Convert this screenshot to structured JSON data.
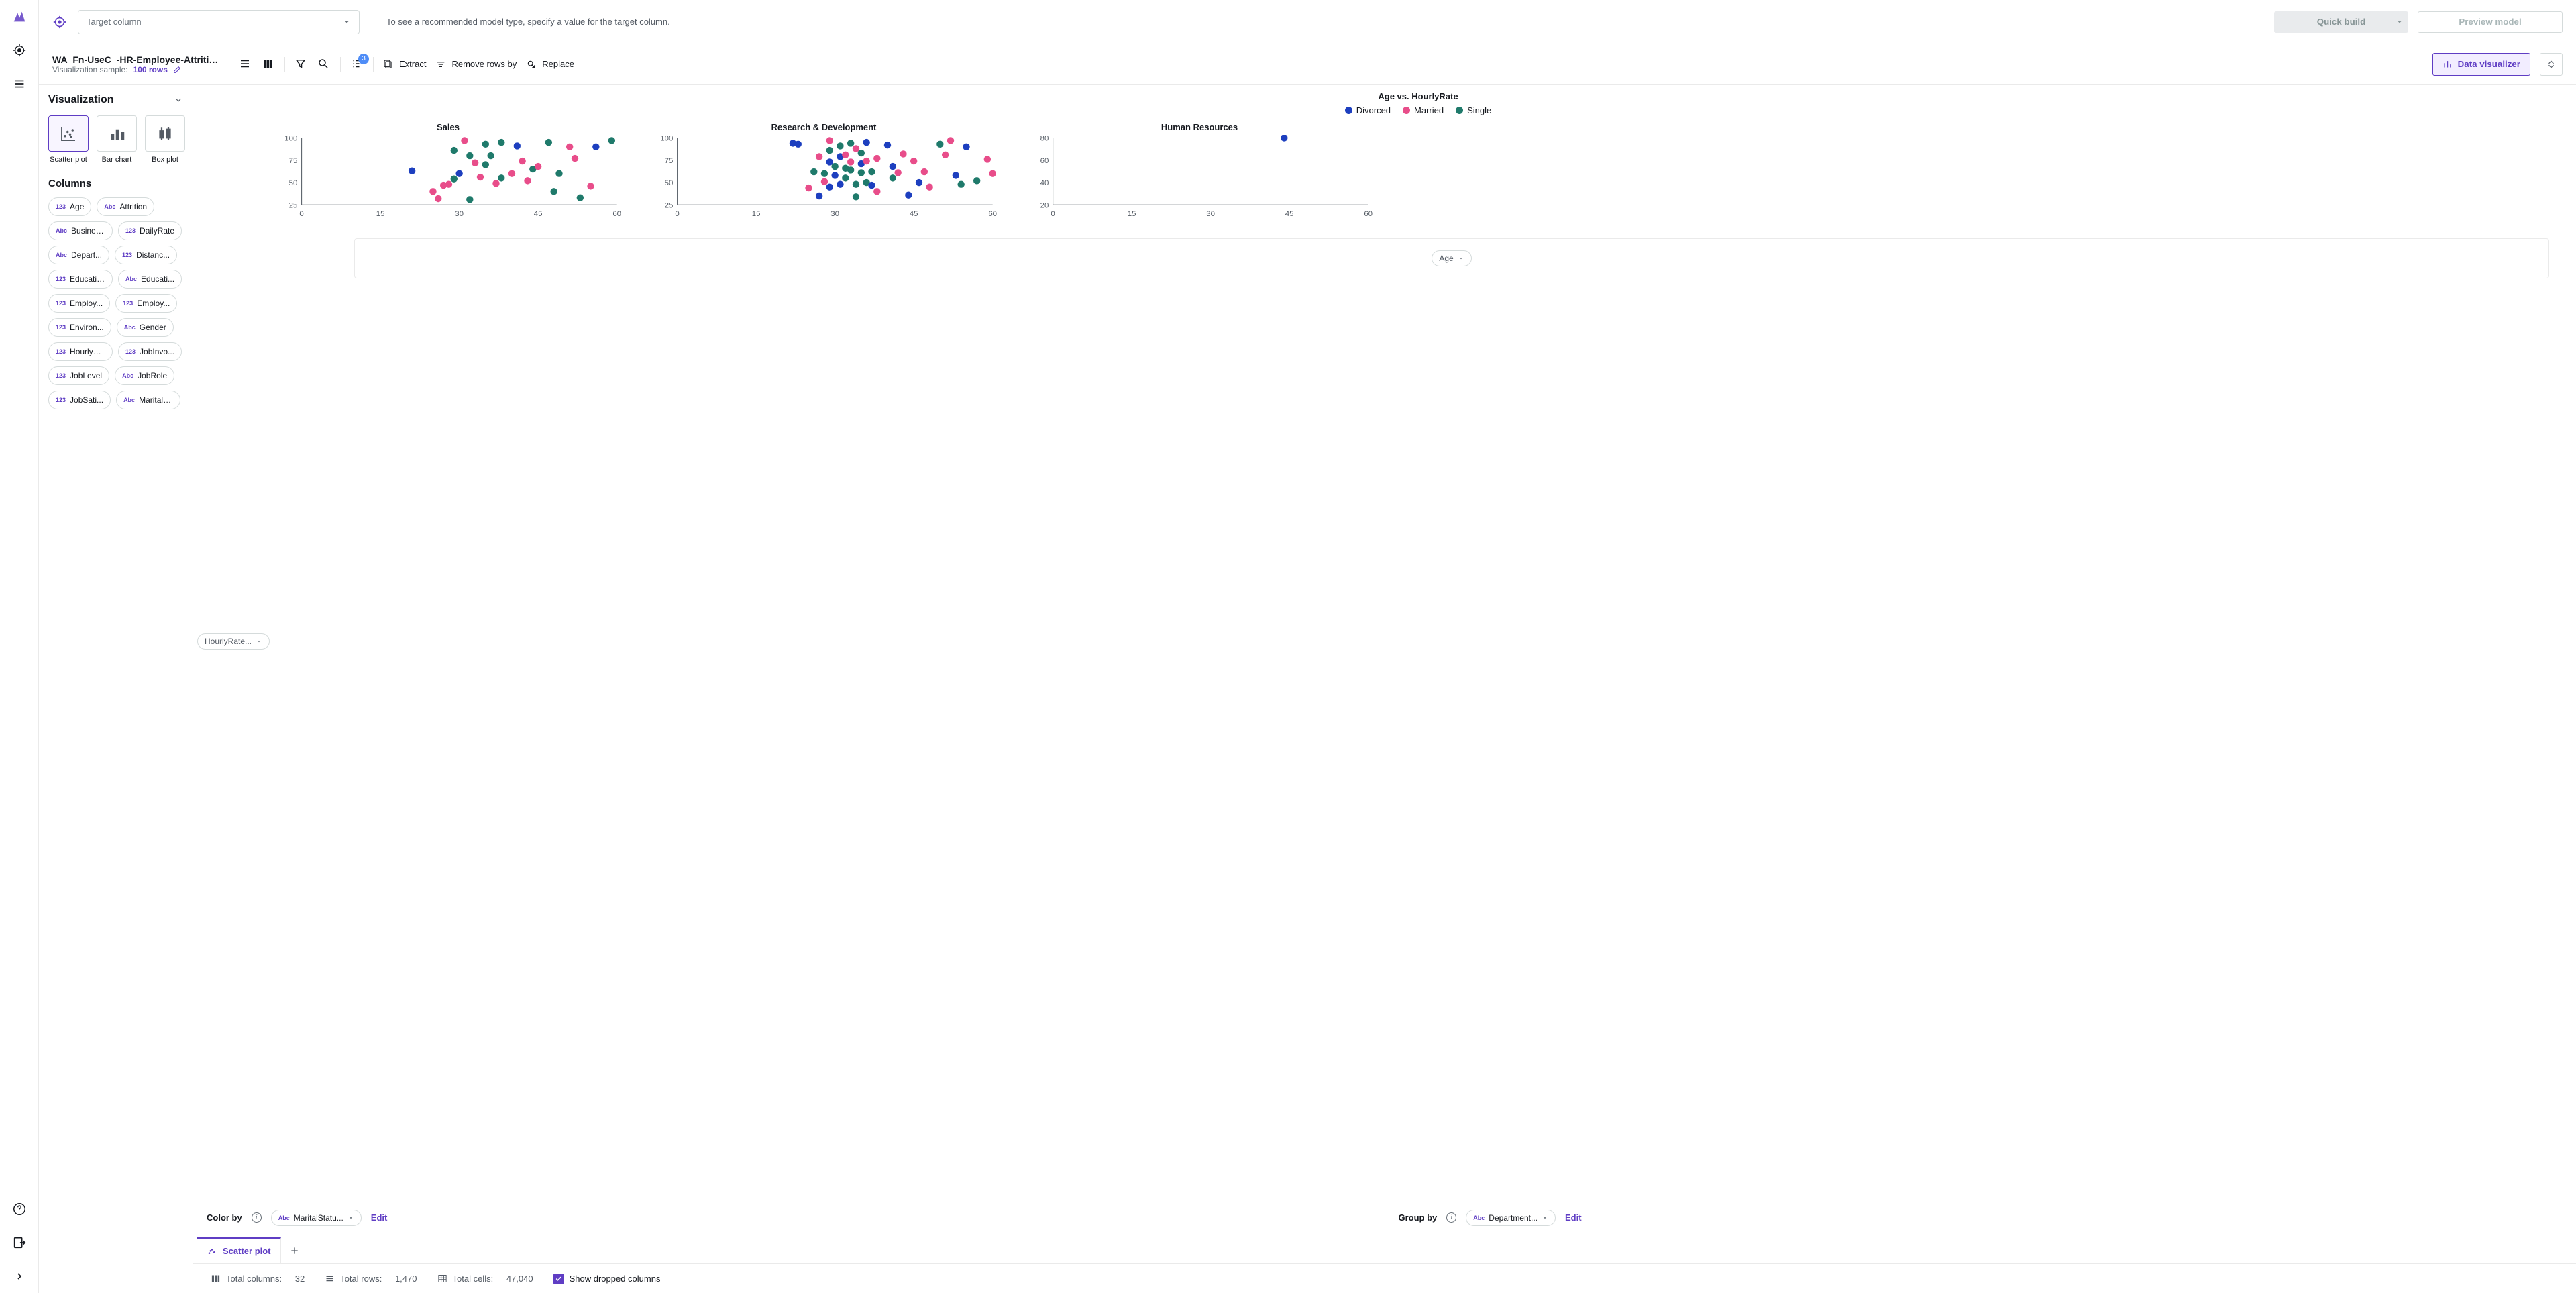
{
  "topbar": {
    "target_placeholder": "Target column",
    "message": "To see a recommended model type, specify a value for the target column.",
    "quick_build": "Quick build",
    "preview_model": "Preview model"
  },
  "filebar": {
    "title": "WA_Fn-UseC_-HR-Employee-Attrition...",
    "sample_label": "Visualization sample:",
    "sample_value": "100 rows",
    "extract": "Extract",
    "remove_rows": "Remove rows by",
    "replace": "Replace",
    "data_visualizer": "Data visualizer",
    "badge": "3"
  },
  "leftpanel": {
    "viz_header": "Visualization",
    "types": [
      {
        "label": "Scatter plot",
        "active": true
      },
      {
        "label": "Bar chart",
        "active": false
      },
      {
        "label": "Box plot",
        "active": false
      }
    ],
    "columns_header": "Columns",
    "columns": [
      {
        "type": "123",
        "name": "Age"
      },
      {
        "type": "Abc",
        "name": "Attrition"
      },
      {
        "type": "Abc",
        "name": "Busines..."
      },
      {
        "type": "123",
        "name": "DailyRate"
      },
      {
        "type": "Abc",
        "name": "Depart..."
      },
      {
        "type": "123",
        "name": "Distanc..."
      },
      {
        "type": "123",
        "name": "Education"
      },
      {
        "type": "Abc",
        "name": "Educati..."
      },
      {
        "type": "123",
        "name": "Employ..."
      },
      {
        "type": "123",
        "name": "Employ..."
      },
      {
        "type": "123",
        "name": "Environ..."
      },
      {
        "type": "Abc",
        "name": "Gender"
      },
      {
        "type": "123",
        "name": "HourlyR..."
      },
      {
        "type": "123",
        "name": "JobInvo..."
      },
      {
        "type": "123",
        "name": "JobLevel"
      },
      {
        "type": "Abc",
        "name": "JobRole"
      },
      {
        "type": "123",
        "name": "JobSati..."
      },
      {
        "type": "Abc",
        "name": "MaritalS..."
      }
    ]
  },
  "chart_data": {
    "type": "scatter",
    "title": "Age vs. HourlyRate",
    "xlabel": "Age",
    "ylabel": "HourlyRate...",
    "xlim": [
      0,
      60
    ],
    "legend": [
      {
        "name": "Divorced",
        "color": "#1d3fbf"
      },
      {
        "name": "Married",
        "color": "#e84d8a"
      },
      {
        "name": "Single",
        "color": "#1f7a6b"
      }
    ],
    "facets": [
      {
        "name": "Sales",
        "ylim": [
          25,
          100
        ],
        "yticks": [
          25,
          50,
          75,
          100
        ],
        "xticks": [
          0,
          15,
          30,
          45,
          60
        ],
        "points": [
          {
            "x": 21,
            "y": 63,
            "c": 0
          },
          {
            "x": 25,
            "y": 40,
            "c": 1
          },
          {
            "x": 26,
            "y": 32,
            "c": 1
          },
          {
            "x": 27,
            "y": 47,
            "c": 1
          },
          {
            "x": 28,
            "y": 48,
            "c": 1
          },
          {
            "x": 29,
            "y": 54,
            "c": 2
          },
          {
            "x": 29,
            "y": 86,
            "c": 2
          },
          {
            "x": 30,
            "y": 60,
            "c": 0
          },
          {
            "x": 31,
            "y": 97,
            "c": 1
          },
          {
            "x": 32,
            "y": 80,
            "c": 2
          },
          {
            "x": 32,
            "y": 31,
            "c": 2
          },
          {
            "x": 33,
            "y": 72,
            "c": 1
          },
          {
            "x": 34,
            "y": 56,
            "c": 1
          },
          {
            "x": 35,
            "y": 93,
            "c": 2
          },
          {
            "x": 35,
            "y": 70,
            "c": 2
          },
          {
            "x": 36,
            "y": 80,
            "c": 2
          },
          {
            "x": 37,
            "y": 49,
            "c": 1
          },
          {
            "x": 38,
            "y": 95,
            "c": 2
          },
          {
            "x": 38,
            "y": 55,
            "c": 2
          },
          {
            "x": 40,
            "y": 60,
            "c": 1
          },
          {
            "x": 41,
            "y": 91,
            "c": 0
          },
          {
            "x": 42,
            "y": 74,
            "c": 1
          },
          {
            "x": 43,
            "y": 52,
            "c": 1
          },
          {
            "x": 44,
            "y": 65,
            "c": 2
          },
          {
            "x": 45,
            "y": 68,
            "c": 1
          },
          {
            "x": 47,
            "y": 95,
            "c": 2
          },
          {
            "x": 48,
            "y": 40,
            "c": 2
          },
          {
            "x": 49,
            "y": 60,
            "c": 2
          },
          {
            "x": 51,
            "y": 90,
            "c": 1
          },
          {
            "x": 52,
            "y": 77,
            "c": 1
          },
          {
            "x": 53,
            "y": 33,
            "c": 2
          },
          {
            "x": 55,
            "y": 46,
            "c": 1
          },
          {
            "x": 56,
            "y": 90,
            "c": 0
          },
          {
            "x": 59,
            "y": 97,
            "c": 2
          }
        ]
      },
      {
        "name": "Research & Development",
        "ylim": [
          25,
          100
        ],
        "yticks": [
          25,
          50,
          75,
          100
        ],
        "xticks": [
          0,
          15,
          30,
          45,
          60
        ],
        "points": [
          {
            "x": 22,
            "y": 94,
            "c": 0
          },
          {
            "x": 23,
            "y": 93,
            "c": 0
          },
          {
            "x": 25,
            "y": 44,
            "c": 1
          },
          {
            "x": 26,
            "y": 62,
            "c": 2
          },
          {
            "x": 27,
            "y": 79,
            "c": 1
          },
          {
            "x": 27,
            "y": 35,
            "c": 0
          },
          {
            "x": 28,
            "y": 51,
            "c": 1
          },
          {
            "x": 28,
            "y": 60,
            "c": 2
          },
          {
            "x": 29,
            "y": 97,
            "c": 1
          },
          {
            "x": 29,
            "y": 86,
            "c": 2
          },
          {
            "x": 29,
            "y": 73,
            "c": 0
          },
          {
            "x": 29,
            "y": 45,
            "c": 0
          },
          {
            "x": 30,
            "y": 58,
            "c": 0
          },
          {
            "x": 30,
            "y": 68,
            "c": 2
          },
          {
            "x": 31,
            "y": 79,
            "c": 0
          },
          {
            "x": 31,
            "y": 91,
            "c": 2
          },
          {
            "x": 31,
            "y": 48,
            "c": 0
          },
          {
            "x": 32,
            "y": 66,
            "c": 2
          },
          {
            "x": 32,
            "y": 81,
            "c": 1
          },
          {
            "x": 32,
            "y": 55,
            "c": 2
          },
          {
            "x": 33,
            "y": 94,
            "c": 2
          },
          {
            "x": 33,
            "y": 73,
            "c": 1
          },
          {
            "x": 33,
            "y": 64,
            "c": 2
          },
          {
            "x": 34,
            "y": 88,
            "c": 1
          },
          {
            "x": 34,
            "y": 48,
            "c": 2
          },
          {
            "x": 34,
            "y": 34,
            "c": 2
          },
          {
            "x": 35,
            "y": 71,
            "c": 0
          },
          {
            "x": 35,
            "y": 61,
            "c": 2
          },
          {
            "x": 35,
            "y": 83,
            "c": 2
          },
          {
            "x": 36,
            "y": 95,
            "c": 0
          },
          {
            "x": 36,
            "y": 50,
            "c": 2
          },
          {
            "x": 36,
            "y": 74,
            "c": 1
          },
          {
            "x": 37,
            "y": 62,
            "c": 2
          },
          {
            "x": 37,
            "y": 47,
            "c": 0
          },
          {
            "x": 38,
            "y": 77,
            "c": 1
          },
          {
            "x": 38,
            "y": 40,
            "c": 1
          },
          {
            "x": 40,
            "y": 92,
            "c": 0
          },
          {
            "x": 41,
            "y": 55,
            "c": 2
          },
          {
            "x": 41,
            "y": 68,
            "c": 0
          },
          {
            "x": 42,
            "y": 61,
            "c": 1
          },
          {
            "x": 43,
            "y": 82,
            "c": 1
          },
          {
            "x": 44,
            "y": 36,
            "c": 0
          },
          {
            "x": 45,
            "y": 74,
            "c": 1
          },
          {
            "x": 46,
            "y": 50,
            "c": 0
          },
          {
            "x": 47,
            "y": 62,
            "c": 1
          },
          {
            "x": 48,
            "y": 45,
            "c": 1
          },
          {
            "x": 50,
            "y": 93,
            "c": 2
          },
          {
            "x": 51,
            "y": 81,
            "c": 1
          },
          {
            "x": 52,
            "y": 97,
            "c": 1
          },
          {
            "x": 53,
            "y": 58,
            "c": 0
          },
          {
            "x": 54,
            "y": 48,
            "c": 2
          },
          {
            "x": 55,
            "y": 90,
            "c": 0
          },
          {
            "x": 57,
            "y": 52,
            "c": 2
          },
          {
            "x": 59,
            "y": 76,
            "c": 1
          },
          {
            "x": 60,
            "y": 60,
            "c": 1
          }
        ]
      },
      {
        "name": "Human Resources",
        "ylim": [
          20,
          80
        ],
        "yticks": [
          20,
          40,
          60,
          80
        ],
        "xticks": [
          0,
          15,
          30,
          45,
          60
        ],
        "points": [
          {
            "x": 44,
            "y": 80,
            "c": 0
          }
        ]
      }
    ]
  },
  "yaxis_pill": "HourlyRate...",
  "xaxis_pill": "Age",
  "controls": {
    "color_by": "Color by",
    "color_val": "MaritalStatu...",
    "group_by": "Group by",
    "group_val": "Department...",
    "edit": "Edit"
  },
  "tab": "Scatter plot",
  "status": {
    "cols_lbl": "Total columns:",
    "cols": "32",
    "rows_lbl": "Total rows:",
    "rows": "1,470",
    "cells_lbl": "Total cells:",
    "cells": "47,040",
    "show_dropped": "Show dropped columns"
  }
}
